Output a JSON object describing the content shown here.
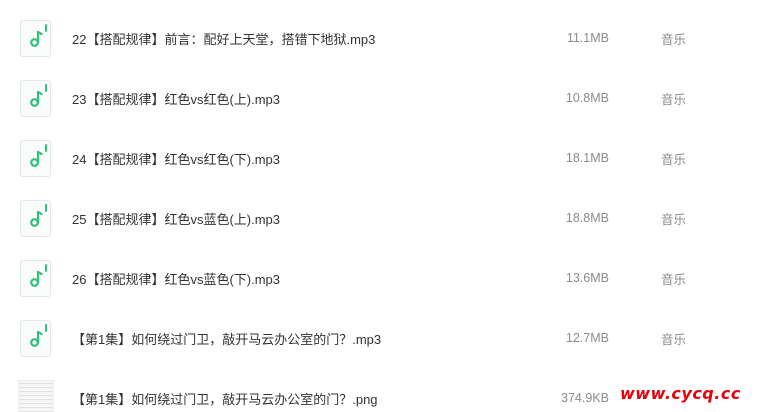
{
  "files": [
    {
      "name": "22【搭配规律】前言：配好上天堂，搭错下地狱.mp3",
      "size": "11.1MB",
      "type": "音乐",
      "icon": "music-file-icon"
    },
    {
      "name": "23【搭配规律】红色vs红色(上).mp3",
      "size": "10.8MB",
      "type": "音乐",
      "icon": "music-file-icon"
    },
    {
      "name": "24【搭配规律】红色vs红色(下).mp3",
      "size": "18.1MB",
      "type": "音乐",
      "icon": "music-file-icon"
    },
    {
      "name": "25【搭配规律】红色vs蓝色(上).mp3",
      "size": "18.8MB",
      "type": "音乐",
      "icon": "music-file-icon"
    },
    {
      "name": "26【搭配规律】红色vs蓝色(下).mp3",
      "size": "13.6MB",
      "type": "音乐",
      "icon": "music-file-icon"
    },
    {
      "name": "【第1集】如何绕过门卫，敲开马云办公室的门？.mp3",
      "size": "12.7MB",
      "type": "音乐",
      "icon": "music-file-icon"
    },
    {
      "name": "【第1集】如何绕过门卫，敲开马云办公室的门？.png",
      "size": "374.9KB",
      "type": "",
      "icon": "image-thumbnail"
    }
  ],
  "watermark": "www.cycq.cc",
  "colors": {
    "accent": "#2fc17a",
    "text": "#333333",
    "muted": "#8c8c8c",
    "watermark": "#e8000a"
  }
}
